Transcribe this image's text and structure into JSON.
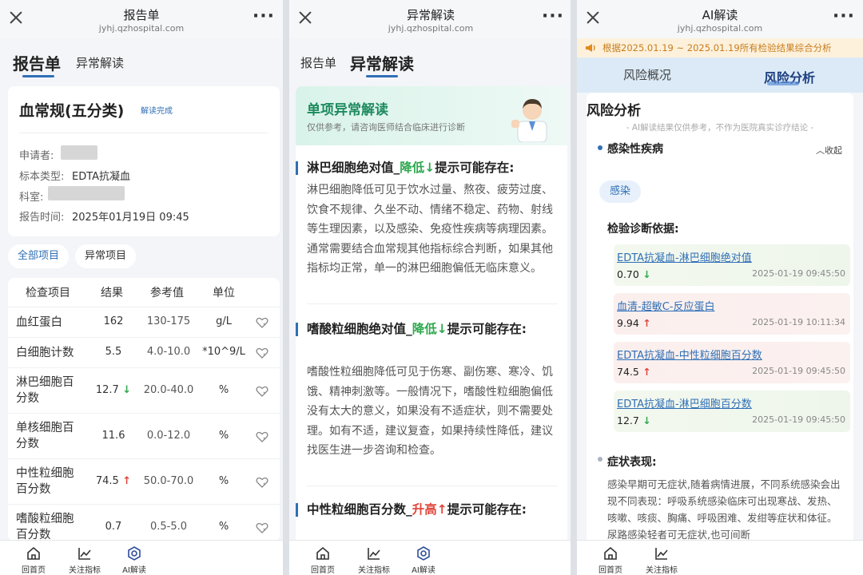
{
  "panel1": {
    "title": "报告单",
    "url": "jyhj.qzhospital.com",
    "tabs": [
      "报告单",
      "异常解读"
    ],
    "card": {
      "title": "血常规(五分类)",
      "status": "解读完成",
      "fields": [
        {
          "label": "申请者:",
          "value": ""
        },
        {
          "label": "标本类型:",
          "value": "EDTA抗凝血"
        },
        {
          "label": "科室:",
          "value": ""
        },
        {
          "label": "报告时间:",
          "value": "2025年01月19日 09:45"
        }
      ]
    },
    "filters": [
      "全部项目",
      "异常项目"
    ],
    "table": {
      "headers": [
        "检查项目",
        "结果",
        "参考值",
        "单位"
      ],
      "rows": [
        {
          "name": "血红蛋白",
          "result": "162",
          "flag": "",
          "ref": "130-175",
          "unit": "g/L"
        },
        {
          "name": "白细胞计数",
          "result": "5.5",
          "flag": "",
          "ref": "4.0-10.0",
          "unit": "*10^9/L"
        },
        {
          "name": "淋巴细胞百分数",
          "result": "12.7",
          "flag": "down",
          "ref": "20.0-40.0",
          "unit": "%"
        },
        {
          "name": "单核细胞百分数",
          "result": "11.6",
          "flag": "",
          "ref": "0.0-12.0",
          "unit": "%"
        },
        {
          "name": "中性粒细胞百分数",
          "result": "74.5",
          "flag": "up",
          "ref": "50.0-70.0",
          "unit": "%"
        },
        {
          "name": "嗜酸粒细胞百分数",
          "result": "0.7",
          "flag": "",
          "ref": "0.5-5.0",
          "unit": "%"
        }
      ]
    }
  },
  "panel2": {
    "title": "异常解读",
    "url": "jyhj.qzhospital.com",
    "tabs": [
      "报告单",
      "异常解读"
    ],
    "header_title": "单项异常解读",
    "header_sub": "仅供参考，请咨询医师结合临床进行诊断",
    "sections": [
      {
        "head_a": "淋巴细胞绝对值_",
        "head_flag": "降低",
        "head_b": "提示可能存在:",
        "arrow": "down",
        "text": "淋巴细胞降低可见于饮水过量、熬夜、疲劳过度、饮食不规律、久坐不动、情绪不稳定、药物、射线等生理因素，以及感染、免疫性疾病等病理因素。通常需要结合血常规其他指标综合判断，如果其他指标均正常，单一的淋巴细胞偏低无临床意义。"
      },
      {
        "head_a": "嗜酸粒细胞绝对值_",
        "head_flag": "降低",
        "head_b": "提示可能存在:",
        "arrow": "down",
        "text": "嗜酸性粒细胞降低可见于伤寒、副伤寒、寒冷、饥饿、精神刺激等。一般情况下，嗜酸性粒细胞偏低没有太大的意义，如果没有不适症状，则不需要处理。如有不适，建议复查，如果持续性降低，建议找医生进一步咨询和检查。"
      },
      {
        "head_a": "中性粒细胞百分数_",
        "head_flag": "升高",
        "head_b": "提示可能存在:",
        "arrow": "up",
        "text": ""
      }
    ]
  },
  "panel3": {
    "title": "AI解读",
    "url": "jyhj.qzhospital.com",
    "banner": "根据2025.01.19 ~ 2025.01.19所有检验结果综合分析",
    "tabs": [
      "风险概况",
      "风险分析"
    ],
    "heading": "风险分析",
    "disclaimer": "- AI解读结果仅供参考，不作为医院真实诊疗结论 -",
    "disease": "感染性疾病",
    "collapse": "收起",
    "tag": "感染",
    "evidence_title": "检验诊断依据:",
    "evidence": [
      {
        "name": "EDTA抗凝血-淋巴细胞绝对值",
        "value": "0.70",
        "flag": "down",
        "date": "2025-01-19 09:45:50"
      },
      {
        "name": "血清-超敏C-反应蛋白",
        "value": "9.94",
        "flag": "up",
        "date": "2025-01-19 10:11:34"
      },
      {
        "name": "EDTA抗凝血-中性粒细胞百分数",
        "value": "74.5",
        "flag": "up",
        "date": "2025-01-19 09:45:50"
      },
      {
        "name": "EDTA抗凝血-淋巴细胞百分数",
        "value": "12.7",
        "flag": "down",
        "date": "2025-01-19 09:45:50"
      }
    ],
    "symptom_title": "症状表现:",
    "symptom_text": "感染早期可无症状,随着病情进展，不同系统感染会出现不同表现：呼吸系统感染临床可出现寒战、发热、咳嗽、咳痰、胸痛、呼吸困难、发绀等症状和体征。尿路感染轻者可无症状,也可间断"
  },
  "nav": [
    "回首页",
    "关注指标",
    "AI解读"
  ],
  "colors": {
    "accent": "#2f6fb6",
    "down": "#2fa84f",
    "up": "#e0453a"
  }
}
